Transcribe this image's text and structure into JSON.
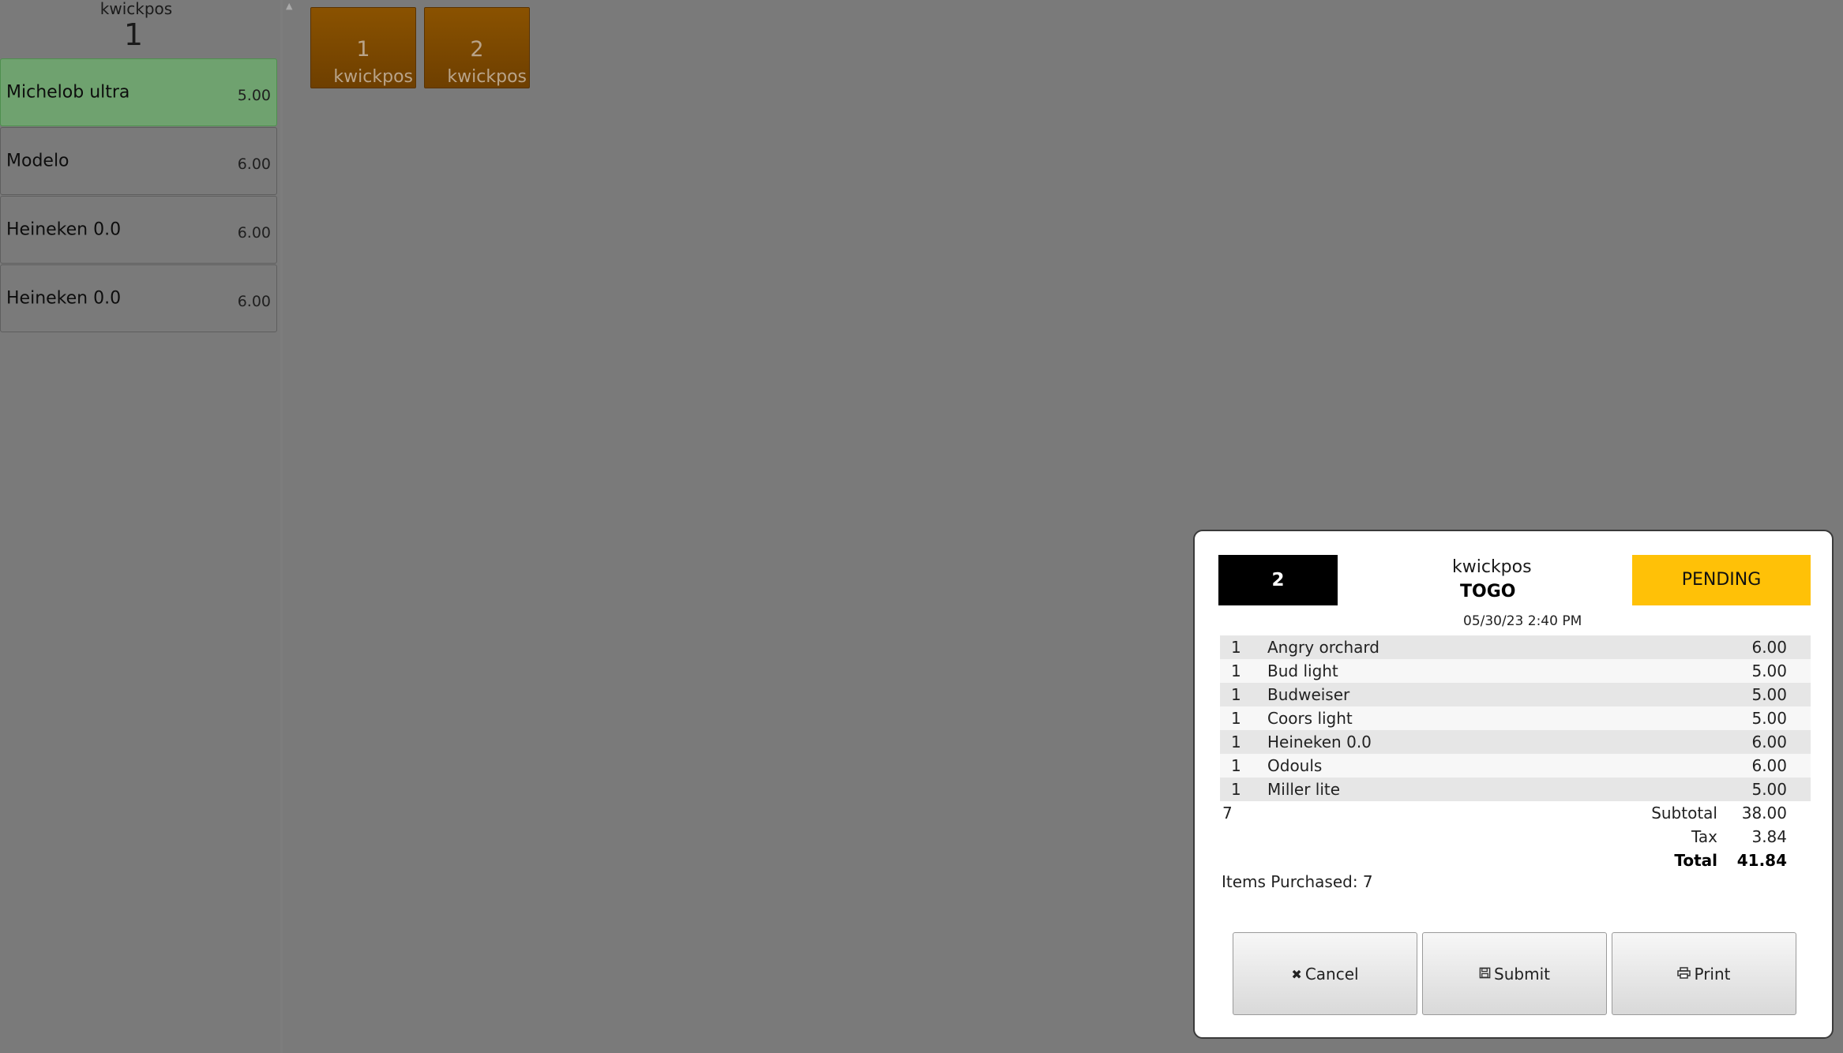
{
  "order_panel": {
    "user": "kwickpos",
    "count": "1",
    "items": [
      {
        "name": "Michelob ultra",
        "price": "5.00",
        "selected": true
      },
      {
        "name": "Modelo",
        "price": "6.00",
        "selected": false
      },
      {
        "name": "Heineken 0.0",
        "price": "6.00",
        "selected": false
      },
      {
        "name": "Heineken 0.0",
        "price": "6.00",
        "selected": false
      }
    ]
  },
  "tickets": [
    {
      "number": "1",
      "user": "kwickpos"
    },
    {
      "number": "2",
      "user": "kwickpos"
    }
  ],
  "colors": {
    "selected_item": "#6fa26f",
    "ticket": "#7a4600",
    "status_pending": "#ffc107"
  },
  "dialog": {
    "order_number": "2",
    "user": "kwickpos",
    "order_type": "TOGO",
    "status": "PENDING",
    "datetime": "05/30/23 2:40 PM",
    "items": [
      {
        "qty": "1",
        "name": "Angry orchard",
        "price": "6.00"
      },
      {
        "qty": "1",
        "name": "Bud light",
        "price": "5.00"
      },
      {
        "qty": "1",
        "name": "Budweiser",
        "price": "5.00"
      },
      {
        "qty": "1",
        "name": "Coors light",
        "price": "5.00"
      },
      {
        "qty": "1",
        "name": "Heineken 0.0",
        "price": "6.00"
      },
      {
        "qty": "1",
        "name": "Odouls",
        "price": "6.00"
      },
      {
        "qty": "1",
        "name": "Miller lite",
        "price": "5.00"
      }
    ],
    "item_count": "7",
    "subtotal_label": "Subtotal",
    "subtotal": "38.00",
    "tax_label": "Tax",
    "tax": "3.84",
    "total_label": "Total",
    "total": "41.84",
    "items_purchased": "Items Purchased: 7",
    "buttons": {
      "cancel": "Cancel",
      "submit": "Submit",
      "print": "Print"
    }
  }
}
